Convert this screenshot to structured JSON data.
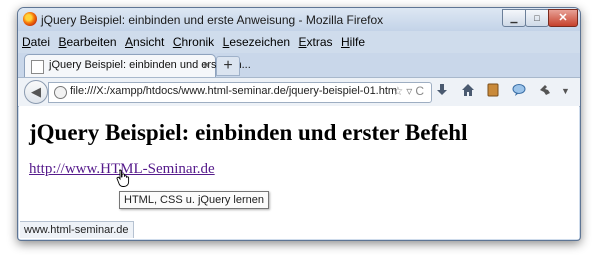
{
  "window": {
    "title": "jQuery Beispiel: einbinden und erste Anweisung - Mozilla Firefox",
    "min_symbol": "▁",
    "max_symbol": "□",
    "close_symbol": "✕"
  },
  "menu": {
    "items": [
      {
        "first": "D",
        "rest": "atei"
      },
      {
        "first": "B",
        "rest": "earbeiten"
      },
      {
        "first": "A",
        "rest": "nsicht"
      },
      {
        "first": "C",
        "rest": "hronik"
      },
      {
        "first": "L",
        "rest": "esezeichen"
      },
      {
        "first": "E",
        "rest": "xtras"
      },
      {
        "first": "H",
        "rest": "ilfe"
      }
    ]
  },
  "tab": {
    "label": "jQuery Beispiel: einbinden und erste An...",
    "close_symbol": "×",
    "new_tab_symbol": "+"
  },
  "nav": {
    "url": "file:///X:/xampp/htdocs/www.html-seminar.de/jquery-beispiel-01.htm",
    "back_symbol": "◀",
    "url_icons": "☆▿C",
    "icons": [
      "download-icon",
      "home-icon",
      "bookmarks-icon",
      "chat-icon",
      "addon-icon",
      "menu-icon"
    ]
  },
  "content": {
    "heading": "jQuery Beispiel: einbinden und erster Befehl",
    "link": "http://www.HTML-Seminar.de",
    "tooltip": "HTML, CSS u. jQuery lernen"
  },
  "status": {
    "text": "www.html-seminar.de"
  }
}
